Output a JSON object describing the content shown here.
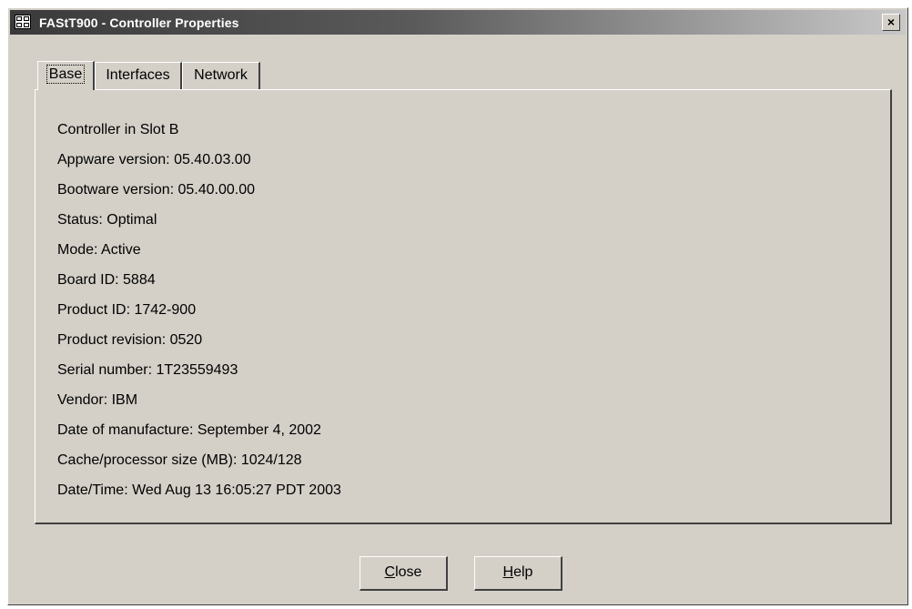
{
  "window": {
    "title": "FAStT900 - Controller Properties",
    "close_glyph": "×",
    "icon": "app-grid-icon"
  },
  "tabs": [
    {
      "label": "Base",
      "active": true
    },
    {
      "label": "Interfaces",
      "active": false
    },
    {
      "label": "Network",
      "active": false
    }
  ],
  "properties": [
    "Controller in Slot B",
    "Appware version: 05.40.03.00",
    "Bootware version: 05.40.00.00",
    "Status: Optimal",
    "Mode: Active",
    "Board ID: 5884",
    "Product ID: 1742-900",
    "Product revision: 0520",
    "Serial number: 1T23559493",
    "Vendor: IBM",
    "Date of manufacture: September 4, 2002",
    "Cache/processor size (MB): 1024/128",
    "Date/Time: Wed Aug 13 16:05:27 PDT 2003"
  ],
  "buttons": {
    "close_label": "Close",
    "help_label": "Help"
  },
  "colors": {
    "dialog_background": "#d4d0c8",
    "titlebar_dark": "#3a3a3a",
    "titlebar_light": "#c8c8c8"
  }
}
